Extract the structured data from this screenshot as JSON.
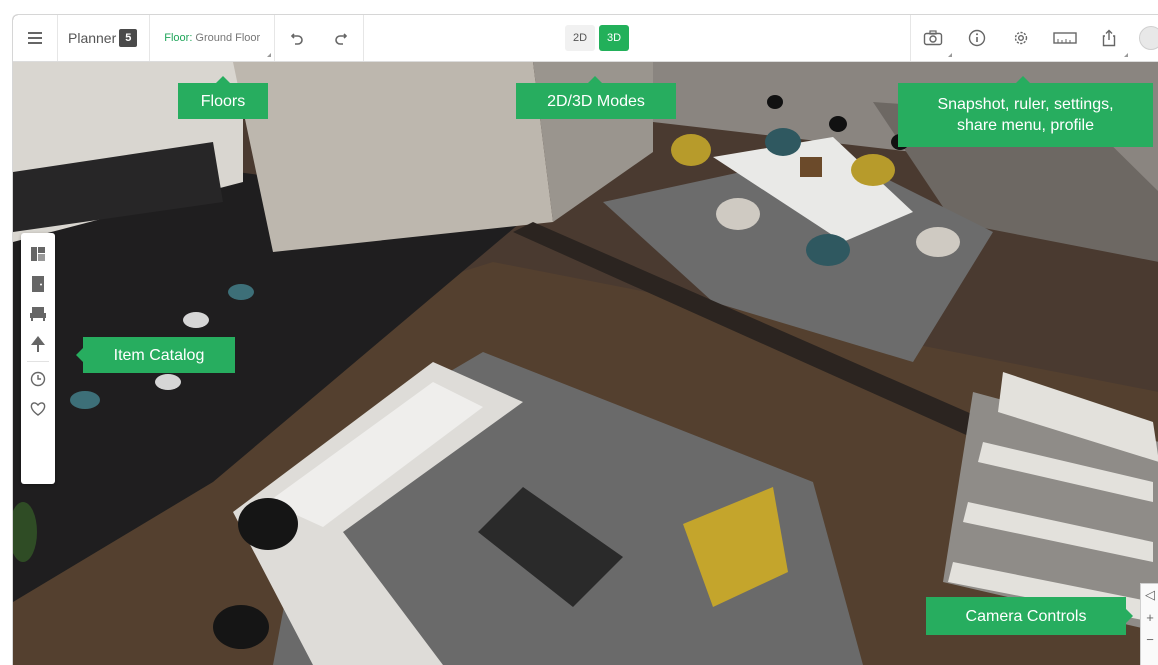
{
  "toolbar": {
    "logo_text": "Planner",
    "logo_badge": "5",
    "floor_prefix": "Floor:",
    "floor_name": "Ground Floor",
    "mode_2d": "2D",
    "mode_3d": "3D",
    "active_mode": "3D",
    "accent_color": "#22b05a"
  },
  "icons": {
    "menu": "hamburger-icon",
    "undo": "undo-icon",
    "redo": "redo-icon",
    "snapshot": "camera-icon",
    "info": "info-icon",
    "settings": "gear-icon",
    "ruler": "ruler-icon",
    "share": "share-icon",
    "profile": "avatar"
  },
  "catalog": {
    "items": [
      "floorplan-icon",
      "door-icon",
      "furniture-icon",
      "tree-icon",
      "history-icon",
      "heart-icon"
    ]
  },
  "callouts": {
    "floors": "Floors",
    "modes": "2D/3D Modes",
    "tools_line1": "Snapshot, ruler, settings,",
    "tools_line2": "share menu, profile",
    "catalog": "Item Catalog",
    "camera": "Camera Controls"
  },
  "camera_controls": {
    "zoom_in": "+",
    "zoom_out": "−",
    "rotate": "◁"
  }
}
